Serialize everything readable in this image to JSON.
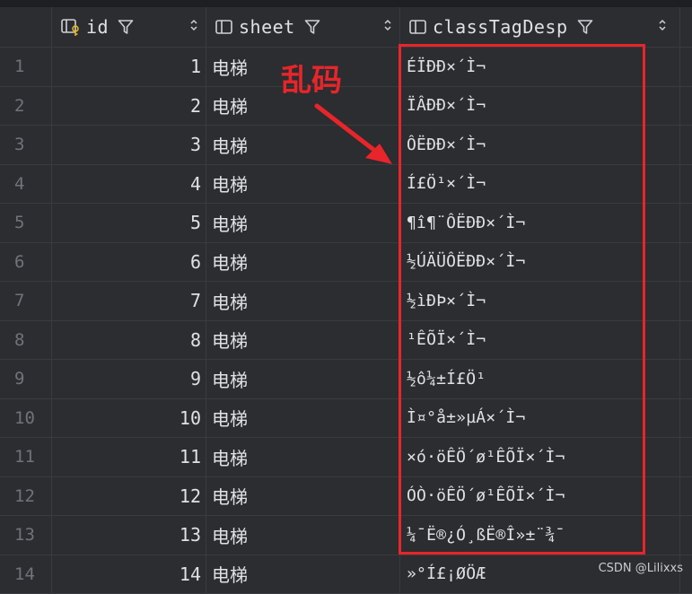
{
  "columns": {
    "id": {
      "label": "id",
      "icon": "key-column-icon"
    },
    "sheet": {
      "label": "sheet",
      "icon": "column-icon"
    },
    "classTagDesp": {
      "label": "classTagDesp",
      "icon": "column-icon"
    }
  },
  "rows": [
    {
      "n": "1",
      "id": "1",
      "sheet": "电梯",
      "desp": "ÉÏÐÐ×´Ì¬"
    },
    {
      "n": "2",
      "id": "2",
      "sheet": "电梯",
      "desp": "ÏÂÐÐ×´Ì¬"
    },
    {
      "n": "3",
      "id": "3",
      "sheet": "电梯",
      "desp": "ÔËÐÐ×´Ì¬"
    },
    {
      "n": "4",
      "id": "4",
      "sheet": "电梯",
      "desp": "Í£Ö¹×´Ì¬"
    },
    {
      "n": "5",
      "id": "5",
      "sheet": "电梯",
      "desp": "¶î¶¨ÔËÐÐ×´Ì¬"
    },
    {
      "n": "6",
      "id": "6",
      "sheet": "电梯",
      "desp": "½ÚÄÜÔËÐÐ×´Ì¬"
    },
    {
      "n": "7",
      "id": "7",
      "sheet": "电梯",
      "desp": "½ìÐÞ×´Ì¬"
    },
    {
      "n": "8",
      "id": "8",
      "sheet": "电梯",
      "desp": "¹ÊÕÏ×´Ì¬"
    },
    {
      "n": "9",
      "id": "9",
      "sheet": "电梯",
      "desp": "½ô¼±Í£Ö¹"
    },
    {
      "n": "10",
      "id": "10",
      "sheet": "电梯",
      "desp": "Ì¤°å±»µÁ×´Ì¬"
    },
    {
      "n": "11",
      "id": "11",
      "sheet": "电梯",
      "desp": "×ó·öÊÖ´ø¹ÊÕÏ×´Ì¬"
    },
    {
      "n": "12",
      "id": "12",
      "sheet": "电梯",
      "desp": "ÓÒ·öÊÖ´ø¹ÊÕÏ×´Ì¬"
    },
    {
      "n": "13",
      "id": "13",
      "sheet": "电梯",
      "desp": "¼¯Ë®¿Ó¸ßË®Î»±¨¾¯"
    },
    {
      "n": "14",
      "id": "14",
      "sheet": "电梯",
      "desp": "»°Í£¡ØÖÆ"
    }
  ],
  "annotation": {
    "text": "乱码"
  },
  "watermark": "CSDN @Lilixxs",
  "colors": {
    "background": "#2b2d30",
    "grid": "#393b40",
    "highlight": "#e8252a",
    "text": "#dfe1e5"
  }
}
